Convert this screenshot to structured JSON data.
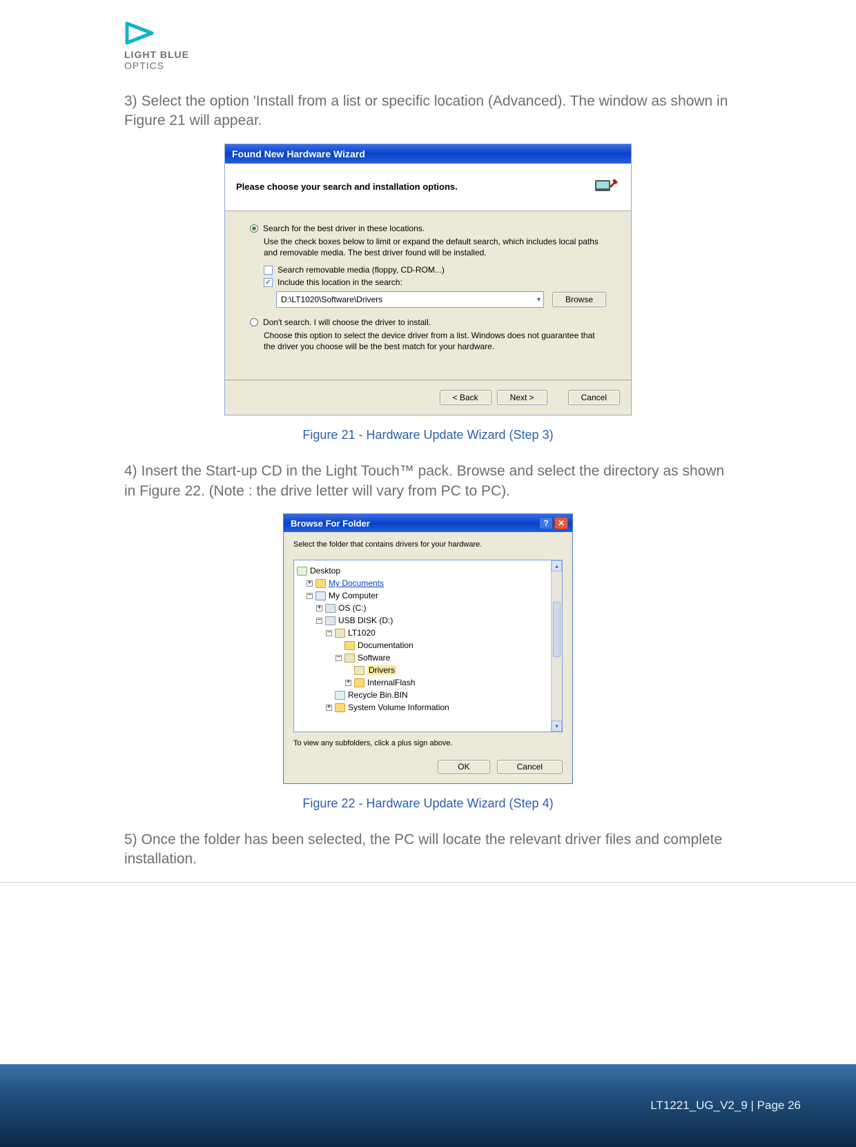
{
  "logo": {
    "line1": "LIGHT BLUE",
    "line2": "OPTICS"
  },
  "para_step3": "3) Select the option 'Install from a list or specific location (Advanced). The window as shown in Figure 21 will appear.",
  "caption21": "Figure 21 - Hardware Update Wizard (Step 3)",
  "para_step4": "4) Insert the Start-up CD in the Light Touch™ pack. Browse and select the directory as shown in Figure 22. (Note : the drive letter will vary from PC to PC).",
  "caption22": "Figure 22 - Hardware Update Wizard (Step 4)",
  "para_step5": "5) Once the folder has been selected, the PC will locate the relevant driver files and complete installation.",
  "footer": "LT1221_UG_V2_9 | Page 26",
  "wizard1": {
    "title": "Found New Hardware Wizard",
    "heading": "Please choose your search and installation options.",
    "opt1": "Search for the best driver in these locations.",
    "opt1_desc": "Use the check boxes below to limit or expand the default search, which includes local paths and removable media. The best driver found will be installed.",
    "chk1": "Search removable media (floppy, CD-ROM...)",
    "chk2": "Include this location in the search:",
    "path": "D:\\LT1020\\Software\\Drivers",
    "browse": "Browse",
    "opt2": "Don't search. I will choose the driver to install.",
    "opt2_desc": "Choose this option to select the device driver from a list.  Windows does not guarantee that the driver you choose will be the best match for your hardware.",
    "back": "< Back",
    "next": "Next >",
    "cancel": "Cancel"
  },
  "browse": {
    "title": "Browse For Folder",
    "msg": "Select the folder that contains drivers for your hardware.",
    "note": "To view any subfolders, click a plus sign above.",
    "ok": "OK",
    "cancel": "Cancel",
    "tree": {
      "desktop": "Desktop",
      "mydocs": "My Documents",
      "mycomp": "My Computer",
      "os": "OS (C:)",
      "usb": "USB DISK (D:)",
      "lt1020": "LT1020",
      "documentation": "Documentation",
      "software": "Software",
      "drivers": "Drivers",
      "internalflash": "InternalFlash",
      "recycle": "Recycle Bin.BIN",
      "sysvol": "System Volume Information"
    }
  }
}
